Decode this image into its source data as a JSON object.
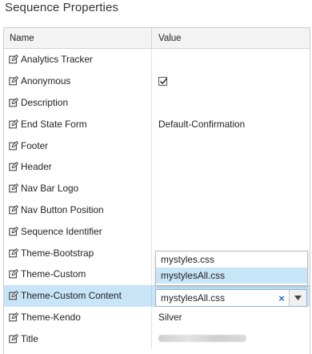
{
  "panel": {
    "title": "Sequence Properties"
  },
  "grid": {
    "columns": {
      "name": "Name",
      "value": "Value"
    },
    "rows": [
      {
        "name": "Analytics Tracker",
        "value": ""
      },
      {
        "name": "Anonymous",
        "value": "",
        "checked": true
      },
      {
        "name": "Description",
        "value": ""
      },
      {
        "name": "End State Form",
        "value": "Default-Confirmation"
      },
      {
        "name": "Footer",
        "value": ""
      },
      {
        "name": "Header",
        "value": ""
      },
      {
        "name": "Nav Bar Logo",
        "value": ""
      },
      {
        "name": "Nav Button Position",
        "value": ""
      },
      {
        "name": "Sequence Identifier",
        "value": ""
      },
      {
        "name": "Theme-Bootstrap",
        "value": ""
      },
      {
        "name": "Theme-Custom",
        "value": ""
      },
      {
        "name": "Theme-Custom Content",
        "value": "mystylesAll.css",
        "selected": true
      },
      {
        "name": "Theme-Kendo",
        "value": "Silver"
      },
      {
        "name": "Title",
        "value": "",
        "redacted": true
      }
    ]
  },
  "dropdown": {
    "options": [
      "mystyles.css",
      "mystylesAll.css"
    ],
    "highlighted_index": 1,
    "clear_symbol": "×"
  },
  "icons": {
    "row_icon": "edit-icon",
    "dropdown_arrow": "triangle-down-icon"
  },
  "colors": {
    "selection": "#c8e4f7",
    "accent": "#1a6fc4"
  }
}
